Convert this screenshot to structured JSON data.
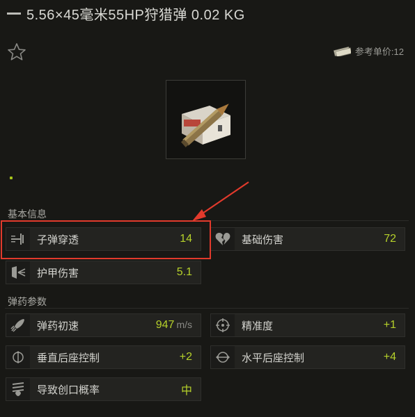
{
  "header": {
    "title": "5.56×45毫米55HP狩猎弹 0.02 KG"
  },
  "price": {
    "label": "参考单价:12"
  },
  "sections": {
    "basic": "基本信息",
    "ammo": "弹药参数"
  },
  "stats": {
    "penetration": {
      "label": "子弹穿透",
      "value": "14"
    },
    "base_damage": {
      "label": "基础伤害",
      "value": "72"
    },
    "armor_damage": {
      "label": "护甲伤害",
      "value": "5.1"
    },
    "muzzle_velocity": {
      "label": "弹药初速",
      "value": "947",
      "unit": "m/s"
    },
    "accuracy": {
      "label": "精准度",
      "value": "+1"
    },
    "vertical_recoil": {
      "label": "垂直后座控制",
      "value": "+2"
    },
    "horizontal_recoil": {
      "label": "水平后座控制",
      "value": "+4"
    },
    "bleed_chance": {
      "label": "导致创口概率",
      "value": "中"
    }
  },
  "colors": {
    "value_green": "#b6d12a",
    "highlight_red": "#e23a2c",
    "background": "#181815"
  },
  "icons": [
    "star-icon",
    "money-icon",
    "penetration-icon",
    "broken-heart-icon",
    "armor-damage-icon",
    "rocket-icon",
    "crosshair-icon",
    "vertical-recoil-icon",
    "horizontal-recoil-icon",
    "bleed-icon"
  ]
}
